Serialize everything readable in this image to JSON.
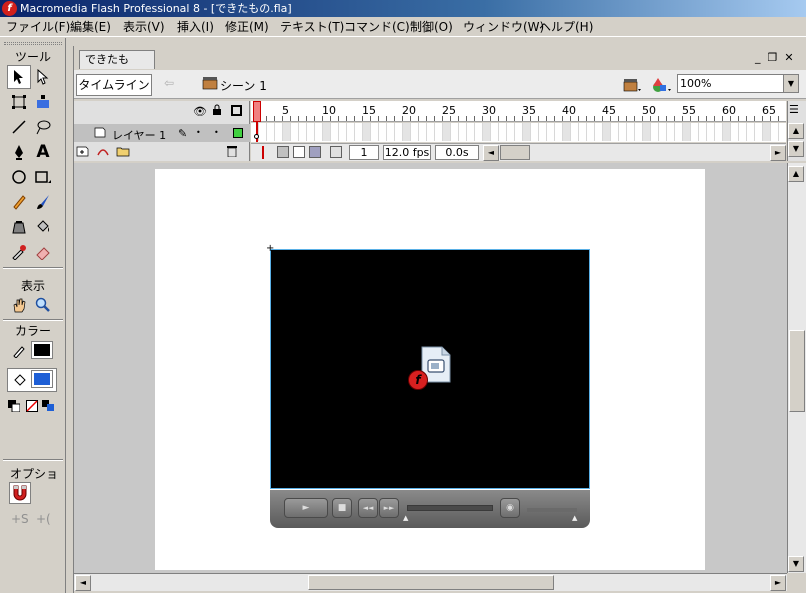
{
  "window": {
    "title": "Macromedia Flash Professional 8 - [できたもの.fla]",
    "app_icon_glyph": "f"
  },
  "menu": [
    "ファイル(F)",
    "編集(E)",
    "表示(V)",
    "挿入(I)",
    "修正(M)",
    "テキスト(T)",
    "コマンド(C)",
    "制御(O)",
    "ウィンドウ(W)",
    "ヘルプ(H)"
  ],
  "tools_panel": {
    "title": "ツール",
    "view_label": "表示",
    "color_label": "カラー",
    "options_label": "オプション",
    "stroke_color": "#000000",
    "fill_color": "#1e5fd6",
    "tools": [
      "selection-tool",
      "subselection-tool",
      "free-transform-tool",
      "gradient-transform-tool",
      "line-tool",
      "lasso-tool",
      "pen-tool",
      "text-tool",
      "oval-tool",
      "rectangle-tool",
      "pencil-tool",
      "brush-tool",
      "ink-bottle-tool",
      "paint-bucket-tool",
      "eyedropper-tool",
      "eraser-tool",
      "hand-tool",
      "zoom-tool"
    ],
    "text_tool_glyph": "A"
  },
  "document": {
    "tab_label": "できたもの.fla",
    "timeline_button": "タイムライン",
    "scene_label": "シーン 1",
    "zoom": "100%"
  },
  "timeline": {
    "ruler_numbers": [
      "1",
      "5",
      "10",
      "15",
      "20",
      "25",
      "30",
      "35",
      "40",
      "45",
      "50",
      "55",
      "60",
      "65"
    ],
    "layer_name": "レイヤー 1",
    "current_frame": "1",
    "frame_rate": "12.0 fps",
    "elapsed": "0.0s"
  },
  "player_controls": {
    "play": "►",
    "stop": "■",
    "back": "◄◄",
    "forward": "►►",
    "volume": "◉"
  }
}
